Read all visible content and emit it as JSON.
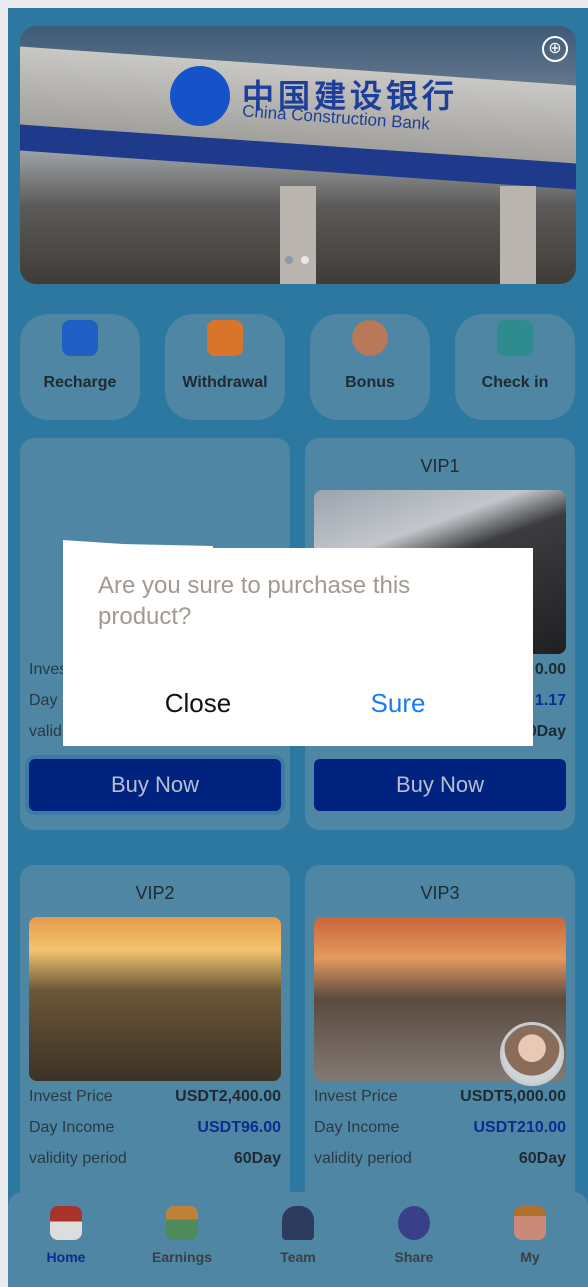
{
  "banner": {
    "logo_cn": "中国建设银行",
    "logo_en": "China Construction Bank",
    "icon": "globe-icon",
    "active_slide": 2,
    "slides": 2
  },
  "quick": [
    {
      "label": "Recharge",
      "icon": "wallet-icon"
    },
    {
      "label": "Withdrawal",
      "icon": "card-icon"
    },
    {
      "label": "Bonus",
      "icon": "bonus-icon"
    },
    {
      "label": "Check in",
      "icon": "check-in-icon"
    }
  ],
  "products": [
    {
      "title": "",
      "rows": [
        {
          "label": "Inves",
          "value": ""
        },
        {
          "label": "Day",
          "value": ""
        },
        {
          "label": "valid",
          "value": ""
        }
      ],
      "buy": "Buy Now"
    },
    {
      "title": "VIP1",
      "rows": [
        {
          "label": "",
          "value": "0.00"
        },
        {
          "label": "",
          "value": "1.17"
        },
        {
          "label": "",
          "value": "0Day"
        }
      ],
      "buy": "Buy Now"
    },
    {
      "title": "VIP2",
      "rows": [
        {
          "label": "Invest Price",
          "value": "USDT2,400.00"
        },
        {
          "label": "Day Income",
          "value": "USDT96.00"
        },
        {
          "label": "validity period",
          "value": "60Day"
        }
      ]
    },
    {
      "title": "VIP3",
      "rows": [
        {
          "label": "Invest Price",
          "value": "USDT5,000.00"
        },
        {
          "label": "Day Income",
          "value": "USDT210.00"
        },
        {
          "label": "validity period",
          "value": "60Day"
        }
      ]
    }
  ],
  "nav": [
    {
      "label": "Home",
      "active": true
    },
    {
      "label": "Earnings"
    },
    {
      "label": "Team"
    },
    {
      "label": "Share"
    },
    {
      "label": "My"
    }
  ],
  "modal": {
    "message": "Are you sure to purchase this product?",
    "close": "Close",
    "sure": "Sure"
  },
  "colors": {
    "accent": "#0e2b8f",
    "sure": "#1a7cf2",
    "bg": "#2c78a1"
  }
}
